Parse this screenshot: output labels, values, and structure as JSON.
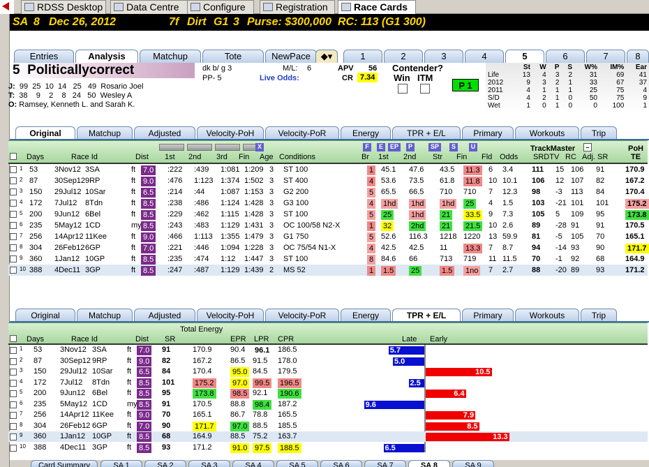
{
  "app_tabs": [
    {
      "label": "RDSS Desktop",
      "icon": "horse-icon"
    },
    {
      "label": "Data Centre",
      "icon": "data-icon"
    },
    {
      "label": "Configure",
      "icon": "configure-icon"
    },
    {
      "label": "Registration",
      "icon": "registration-icon"
    },
    {
      "label": "Race Cards",
      "icon": "racecards-icon"
    }
  ],
  "race_bar": {
    "track": "SA",
    "race": "8",
    "date": "Dec 26, 2012",
    "dist": "7f",
    "surface": "Dirt",
    "grade": "G1",
    "num": "3",
    "purse": "Purse: $300,000",
    "rc": "RC: 113  (G1 300)"
  },
  "view_tabs": [
    "Entries",
    "Analysis",
    "Matchup",
    "Tote",
    "NewPace"
  ],
  "horse_tabs": [
    "1",
    "2",
    "3",
    "4",
    "5",
    "6",
    "7",
    "8"
  ],
  "horse": {
    "num": "5",
    "name": "Politicallycorrect",
    "color": "dk b/ g 3",
    "pp": "PP- 5",
    "ml_label": "M/L:",
    "ml": "6",
    "live_odds": "Live Odds:",
    "apv_label": "APV",
    "apv": "56",
    "cr_label": "CR",
    "cr": "7.34",
    "contender": "Contender?",
    "win": "Win",
    "itm": "ITM",
    "p1": "P 1"
  },
  "jockey": {
    "j_label": "J:",
    "j_stats": [
      "99",
      "25",
      "10",
      "14",
      "25",
      "49"
    ],
    "j_name": "Rosario Joel",
    "t_label": "T:",
    "t_stats": [
      "38",
      "9",
      "2",
      "8",
      "24",
      "50"
    ],
    "t_name": "Wesley A",
    "o_label": "O:",
    "o_name": "Ramsey, Kenneth L. and Sarah K."
  },
  "stats": {
    "headers": [
      "St",
      "W",
      "P",
      "S",
      "W%",
      "IM%",
      "Ear"
    ],
    "rows": [
      [
        "Life",
        "13",
        "4",
        "3",
        "2",
        "31",
        "69",
        "41"
      ],
      [
        "2012",
        "9",
        "3",
        "2",
        "1",
        "33",
        "67",
        "37"
      ],
      [
        "2011",
        "4",
        "1",
        "1",
        "1",
        "25",
        "75",
        "4"
      ],
      [
        "S/D",
        "4",
        "2",
        "1",
        "0",
        "50",
        "75",
        "9"
      ],
      [
        "Wet",
        "1",
        "0",
        "1",
        "0",
        "0",
        "100",
        "1"
      ]
    ]
  },
  "sub_tabs": [
    "Original",
    "Matchup",
    "Adjusted",
    "Velocity-PoH",
    "Velocity-PoR",
    "Energy",
    "TPR + E/L",
    "Primary",
    "Workouts",
    "Trip"
  ],
  "grid1": {
    "headers": {
      "days": "Days",
      "raceid": "Race Id",
      "dist": "Dist",
      "c1st": "1st",
      "c2nd": "2nd",
      "c3rd": "3rd",
      "fin": "Fin",
      "age": "Age",
      "cond": "Conditions",
      "br": "Br",
      "s1st": "1st",
      "s2nd": "2nd",
      "str": "Str",
      "sfin": "Fin",
      "fld": "Fld",
      "odds": "Odds",
      "tm": "TrackMaster",
      "srdtv": "SRDTV",
      "rc": "RC",
      "adj": "Adj. SR",
      "poh": "PoH",
      "te": "TE"
    },
    "pace_btns": [
      "F",
      "E",
      "EP",
      "P",
      "SP",
      "S",
      "U"
    ],
    "rows": [
      [
        "1",
        "53",
        "3Nov12",
        "3SA",
        "ft",
        "7.0",
        ":222",
        ":439",
        "1:081",
        "1:209",
        "3",
        "ST 100",
        "1",
        "45.1",
        "47.6",
        "43.5",
        "11.3",
        "6",
        "3.4",
        "111",
        "15",
        "106",
        "91",
        "170.9"
      ],
      [
        "2",
        "87",
        "30Sep12",
        "9RP",
        "ft",
        "9.0",
        ":476",
        "1:123",
        "1:374",
        "1:502",
        "3",
        "ST 400",
        "4",
        "53.6",
        "73.5",
        "61.8",
        "11.8",
        "10",
        "10.1",
        "106",
        "12",
        "107",
        "82",
        "167.2"
      ],
      [
        "3",
        "150",
        "29Jul12",
        "10Sar",
        "ft",
        "6.5",
        ":214",
        ":44",
        "1:087",
        "1:153",
        "3",
        "G2 200",
        "5",
        "65.5",
        "66.5",
        "710",
        "710",
        "7",
        "12.3",
        "98",
        "-3",
        "113",
        "84",
        "170.4"
      ],
      [
        "4",
        "172",
        "7Jul12",
        "8Tdn",
        "ft",
        "8.5",
        ":238",
        ":486",
        "1:124",
        "1:428",
        "3",
        "G3 100",
        "4",
        "1hd",
        "1hd",
        "1hd",
        "25",
        "4",
        "1.5",
        "103",
        "-21",
        "101",
        "101",
        "175.2"
      ],
      [
        "5",
        "200",
        "9Jun12",
        "6Bel",
        "ft",
        "8.5",
        ":229",
        ":462",
        "1:115",
        "1:428",
        "3",
        "ST 100",
        "5",
        "25",
        "1hd",
        "21",
        "33.5",
        "9",
        "7.3",
        "105",
        "5",
        "109",
        "95",
        "173.8"
      ],
      [
        "6",
        "235",
        "5May12",
        "1CD",
        "my",
        "8.5",
        ":243",
        ":483",
        "1:129",
        "1:431",
        "3",
        "OC 100/58 N2-X",
        "1",
        "32",
        "2hd",
        "21",
        "21.5",
        "10",
        "2.6",
        "89",
        "-28",
        "91",
        "91",
        "170.5"
      ],
      [
        "7",
        "256",
        "14Apr12",
        "11Kee",
        "ft",
        "9.0",
        ":466",
        "1:113",
        "1:355",
        "1:479",
        "3",
        "G1 750",
        "5",
        "52.6",
        "116.3",
        "1218",
        "1220",
        "13",
        "59.9",
        "81",
        "-5",
        "105",
        "70",
        "165.1"
      ],
      [
        "8",
        "304",
        "26Feb12",
        "6GP",
        "ft",
        "7.0",
        ":221",
        ":446",
        "1:094",
        "1:228",
        "3",
        "OC 75/54 N1-X",
        "4",
        "42.5",
        "42.5",
        "11",
        "13.3",
        "7",
        "8.7",
        "94",
        "-14",
        "93",
        "90",
        "171.7"
      ],
      [
        "9",
        "360",
        "1Jan12",
        "10GP",
        "ft",
        "8.5",
        ":235",
        ":474",
        "1:12",
        "1:447",
        "3",
        "ST 100",
        "8",
        "84.6",
        "66",
        "713",
        "719",
        "11",
        "11.5",
        "70",
        "-1",
        "92",
        "68",
        "164.9"
      ],
      [
        "10",
        "388",
        "4Dec11",
        "3GP",
        "ft",
        "8.5",
        ":247",
        ":487",
        "1:129",
        "1:439",
        "2",
        "MS 52",
        "1",
        "1.5",
        "25",
        "1.5",
        "1no",
        "7",
        "2.7",
        "88",
        "-20",
        "89",
        "93",
        "171.2"
      ]
    ]
  },
  "grid2": {
    "headers": {
      "days": "Days",
      "raceid": "Race Id",
      "dist": "Dist",
      "sr": "SR",
      "te": "Total Energy",
      "epr": "EPR",
      "lpr": "LPR",
      "cpr": "CPR",
      "late": "Late",
      "early": "Early"
    },
    "rows": [
      [
        "1",
        "53",
        "3Nov12",
        "3SA",
        "ft",
        "7.0",
        "91",
        "170.9",
        "90.4",
        "96.1",
        "186.5",
        "5.7",
        ""
      ],
      [
        "2",
        "87",
        "30Sep12",
        "9RP",
        "ft",
        "9.0",
        "82",
        "167.2",
        "86.5",
        "91.5",
        "178.0",
        "5.0",
        ""
      ],
      [
        "3",
        "150",
        "29Jul12",
        "10Sar",
        "ft",
        "6.5",
        "84",
        "170.4",
        "95.0",
        "84.5",
        "179.5",
        "",
        "10.5"
      ],
      [
        "4",
        "172",
        "7Jul12",
        "8Tdn",
        "ft",
        "8.5",
        "101",
        "175.2",
        "97.0",
        "99.5",
        "196.5",
        "2.5",
        ""
      ],
      [
        "5",
        "200",
        "9Jun12",
        "6Bel",
        "ft",
        "8.5",
        "95",
        "173.8",
        "98.5",
        "92.1",
        "190.6",
        "",
        "6.4"
      ],
      [
        "6",
        "235",
        "5May12",
        "1CD",
        "my",
        "8.5",
        "91",
        "170.5",
        "88.8",
        "98.4",
        "187.2",
        "9.6",
        ""
      ],
      [
        "7",
        "256",
        "14Apr12",
        "11Kee",
        "ft",
        "9.0",
        "70",
        "165.1",
        "86.7",
        "78.8",
        "165.5",
        "",
        "7.9"
      ],
      [
        "8",
        "304",
        "26Feb12",
        "6GP",
        "ft",
        "7.0",
        "90",
        "171.7",
        "97.0",
        "88.5",
        "185.5",
        "",
        "8.5"
      ],
      [
        "9",
        "360",
        "1Jan12",
        "10GP",
        "ft",
        "8.5",
        "68",
        "164.9",
        "88.5",
        "75.2",
        "163.7",
        "",
        "13.3"
      ],
      [
        "10",
        "388",
        "4Dec11",
        "3GP",
        "ft",
        "8.5",
        "93",
        "171.2",
        "91.0",
        "97.5",
        "188.5",
        "6.5",
        ""
      ]
    ]
  },
  "bottom_tabs": [
    "Card Summary",
    "SA 1",
    "SA 2",
    "SA 3",
    "SA 4",
    "SA 5",
    "SA 6",
    "SA 7",
    "SA 8",
    "SA 9"
  ]
}
